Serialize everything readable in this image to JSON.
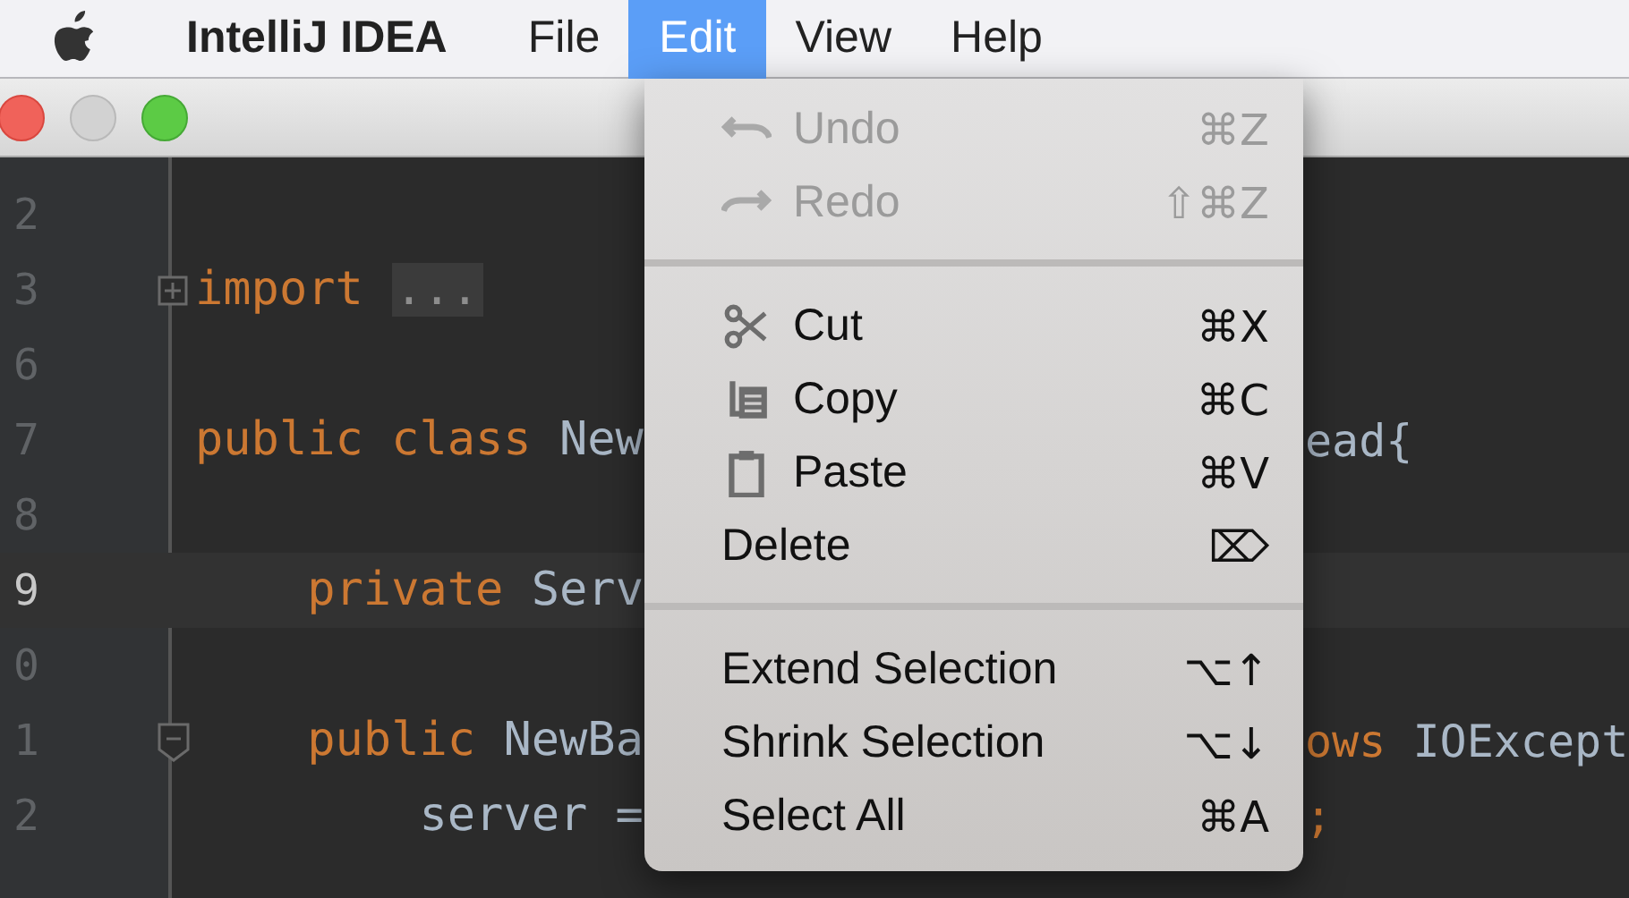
{
  "menu_bar": {
    "app_name": "IntelliJ IDEA",
    "menus": [
      {
        "label": "File",
        "selected": false
      },
      {
        "label": "Edit",
        "selected": true
      },
      {
        "label": "View",
        "selected": false
      },
      {
        "label": "Help",
        "selected": false
      }
    ]
  },
  "editor": {
    "lines": [
      {
        "number": "2",
        "current": false,
        "kind": "plain"
      },
      {
        "number": "3",
        "current": false,
        "kind": "collapsed",
        "code": [
          {
            "kind": "keyword",
            "text": "import"
          },
          {
            "kind": "folded",
            "text": "..."
          }
        ]
      },
      {
        "number": "6",
        "current": false,
        "kind": "plain"
      },
      {
        "number": "7",
        "current": false,
        "kind": "plain",
        "code": [
          {
            "kind": "keyword",
            "text": "public class"
          },
          {
            "kind": "plain",
            "text": "New"
          }
        ],
        "tail": [
          {
            "kind": "plain",
            "text": "ead{"
          }
        ]
      },
      {
        "number": "8",
        "current": false,
        "kind": "plain"
      },
      {
        "number": "9",
        "current": true,
        "kind": "plain",
        "code": [
          {
            "kind": "keyword",
            "text": "    private"
          },
          {
            "kind": "plain",
            "text": "Serv"
          }
        ]
      },
      {
        "number": "0",
        "current": false,
        "kind": "plain"
      },
      {
        "number": "1",
        "current": false,
        "kind": "opening",
        "code": [
          {
            "kind": "keyword",
            "text": "    public"
          },
          {
            "kind": "plain",
            "text": "NewBa"
          }
        ],
        "tail": [
          {
            "kind": "keyword",
            "text": "ows"
          },
          {
            "kind": "plain",
            "text": "IOExcept"
          }
        ]
      },
      {
        "number": "2",
        "current": false,
        "kind": "plain",
        "code": [
          {
            "kind": "plain",
            "text": "        server ="
          }
        ],
        "tail": [
          {
            "kind": "keyword",
            "text": ";"
          }
        ]
      }
    ]
  },
  "edit_menu": {
    "items": [
      {
        "kind": "undo",
        "label": "Undo",
        "shortcut": "⌘Z",
        "disabled": true
      },
      {
        "kind": "redo",
        "label": "Redo",
        "shortcut": "⇧⌘Z",
        "disabled": true
      },
      {
        "kind": "separator"
      },
      {
        "kind": "cut",
        "label": "Cut",
        "shortcut": "⌘X",
        "disabled": false
      },
      {
        "kind": "copy",
        "label": "Copy",
        "shortcut": "⌘C",
        "disabled": false
      },
      {
        "kind": "paste",
        "label": "Paste",
        "shortcut": "⌘V",
        "disabled": false
      },
      {
        "kind": "plain",
        "label": "Delete",
        "shortcut": "⌦",
        "disabled": false
      },
      {
        "kind": "separator"
      },
      {
        "kind": "plain",
        "label": "Extend Selection",
        "shortcut": "⌥↑",
        "disabled": false
      },
      {
        "kind": "plain",
        "label": "Shrink Selection",
        "shortcut": "⌥↓",
        "disabled": false
      },
      {
        "kind": "plain",
        "label": "Select All",
        "shortcut": "⌘A",
        "disabled": false
      }
    ]
  }
}
